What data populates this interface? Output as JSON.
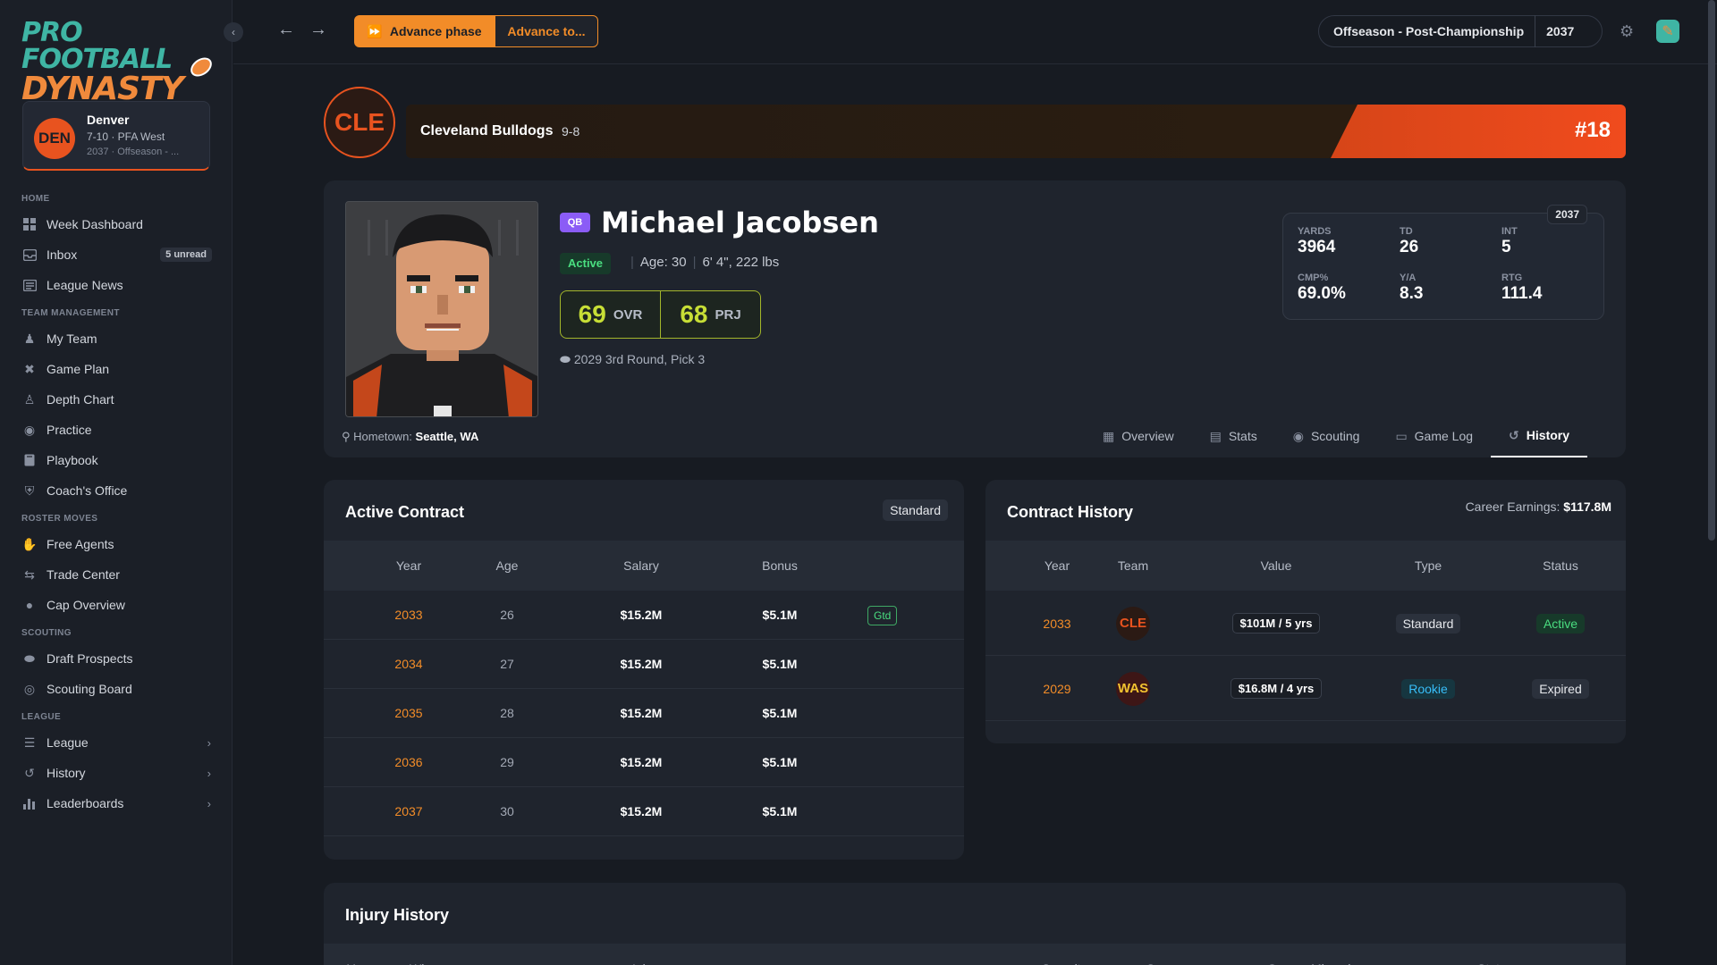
{
  "app": {
    "logo_line1": "PRO FOOTBALL",
    "logo_line2": "DYNASTY"
  },
  "team_card": {
    "abbr": "DEN",
    "name": "Denver",
    "record": "7-10 · PFA West",
    "subtitle": "2037 · Offseason - ..."
  },
  "nav": {
    "home_label": "HOME",
    "week_dashboard": "Week Dashboard",
    "inbox": "Inbox",
    "inbox_count": "5 unread",
    "league_news": "League News",
    "team_mgmt_label": "TEAM MANAGEMENT",
    "my_team": "My Team",
    "game_plan": "Game Plan",
    "depth_chart": "Depth Chart",
    "practice": "Practice",
    "playbook": "Playbook",
    "coachs_office": "Coach's Office",
    "roster_label": "ROSTER MOVES",
    "free_agents": "Free Agents",
    "trade_center": "Trade Center",
    "cap_overview": "Cap Overview",
    "scouting_label": "SCOUTING",
    "draft_prospects": "Draft Prospects",
    "scouting_board": "Scouting Board",
    "league_label": "LEAGUE",
    "league": "League",
    "history": "History",
    "leaderboards": "Leaderboards"
  },
  "topbar": {
    "advance_phase": "Advance phase",
    "advance_to": "Advance to...",
    "phase": "Offseason - Post-Championship",
    "year": "2037"
  },
  "banner": {
    "abbr": "CLE",
    "team_name": "Cleveland Bulldogs",
    "team_record": "9-8",
    "rank": "#18"
  },
  "player": {
    "position": "QB",
    "name": "Michael Jacobsen",
    "status": "Active",
    "age": "Age: 30",
    "size": "6' 4\", 222 lbs",
    "ovr": "69",
    "ovr_label": "OVR",
    "prj": "68",
    "prj_label": "PRJ",
    "draft": "2029 3rd Round, Pick 3",
    "hometown_label": "Hometown:",
    "hometown": "Seattle, WA"
  },
  "season_stats": {
    "year": "2037",
    "yards_label": "YARDS",
    "yards": "3964",
    "td_label": "TD",
    "td": "26",
    "int_label": "INT",
    "int": "5",
    "cmp_label": "CMP%",
    "cmp": "69.0%",
    "ya_label": "Y/A",
    "ya": "8.3",
    "rtg_label": "RTG",
    "rtg": "111.4"
  },
  "tabs": {
    "overview": "Overview",
    "stats": "Stats",
    "scouting": "Scouting",
    "game_log": "Game Log",
    "history": "History"
  },
  "active_contract": {
    "title": "Active Contract",
    "type": "Standard",
    "headers": {
      "year": "Year",
      "age": "Age",
      "salary": "Salary",
      "bonus": "Bonus"
    },
    "guaranteed_label": "Gtd",
    "rows": [
      {
        "year": "2033",
        "age": "26",
        "salary": "$15.2M",
        "bonus": "$5.1M"
      },
      {
        "year": "2034",
        "age": "27",
        "salary": "$15.2M",
        "bonus": "$5.1M"
      },
      {
        "year": "2035",
        "age": "28",
        "salary": "$15.2M",
        "bonus": "$5.1M"
      },
      {
        "year": "2036",
        "age": "29",
        "salary": "$15.2M",
        "bonus": "$5.1M"
      },
      {
        "year": "2037",
        "age": "30",
        "salary": "$15.2M",
        "bonus": "$5.1M"
      }
    ]
  },
  "contract_history": {
    "title": "Contract History",
    "earnings_label": "Career Earnings:",
    "earnings": "$117.8M",
    "headers": {
      "year": "Year",
      "team": "Team",
      "value": "Value",
      "type": "Type",
      "status": "Status"
    },
    "rows": [
      {
        "year": "2033",
        "team": "CLE",
        "value": "$101M / 5 yrs",
        "type": "Standard",
        "status": "Active"
      },
      {
        "year": "2029",
        "team": "WAS",
        "value": "$16.8M / 4 yrs",
        "type": "Rookie",
        "status": "Expired"
      }
    ]
  },
  "injury_history": {
    "title": "Injury History",
    "headers": {
      "year": "Year",
      "when": "When",
      "injury": "Injury",
      "severity": "Severity",
      "surgery": "Surgery",
      "games_missed": "Games Missed",
      "status": "Status"
    }
  },
  "colors": {
    "accent_orange": "#f28c28",
    "team_red": "#e8531f",
    "rating_green": "#c7de36",
    "active_green": "#4ade80",
    "qb_purple": "#8b5cf6"
  }
}
